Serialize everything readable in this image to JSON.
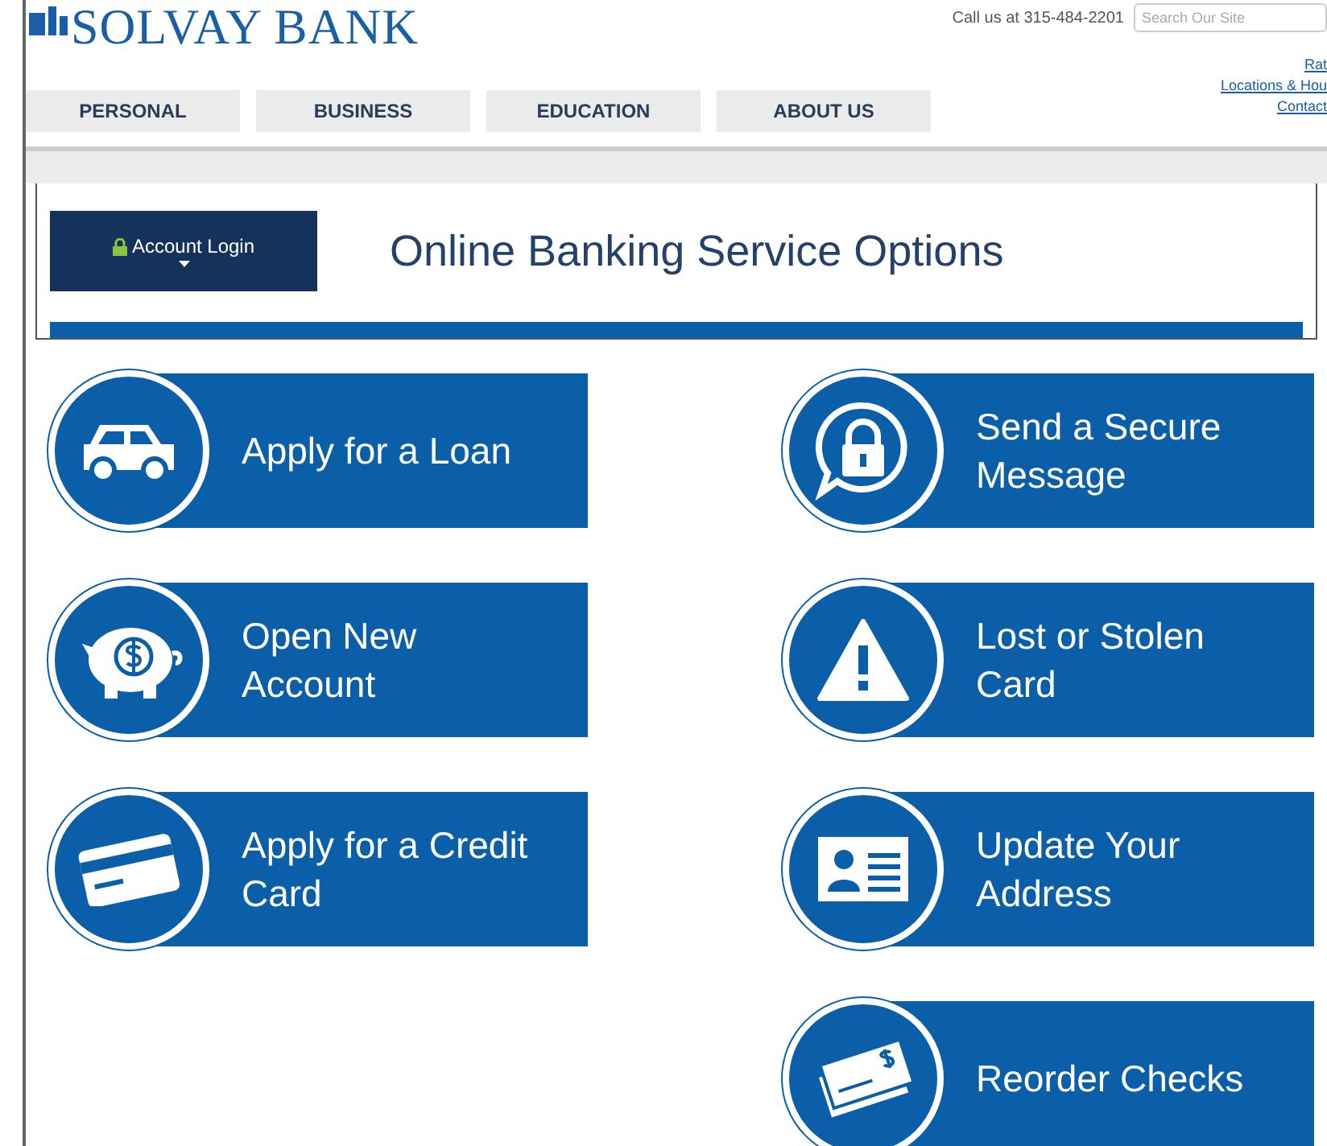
{
  "header": {
    "logo": "SOLVAY BANK",
    "call": "Call us at 315-484-2201",
    "search": {
      "placeholder": "Search Our Site"
    },
    "links": [
      "Rat",
      "Locations & Hou",
      "Contact"
    ]
  },
  "nav": [
    {
      "label": "PERSONAL"
    },
    {
      "label": "BUSINESS"
    },
    {
      "label": "EDUCATION"
    },
    {
      "label": "ABOUT US"
    }
  ],
  "panel": {
    "login_button": "Account Login",
    "title": "Online Banking Service Options"
  },
  "left_options": [
    {
      "kind": "car",
      "label": "Apply for a Loan"
    },
    {
      "kind": "piggy",
      "label": "Open New Account"
    },
    {
      "kind": "card",
      "label": "Apply for a Credit Card"
    }
  ],
  "right_options": [
    {
      "kind": "lock",
      "label": "Send a Secure Message"
    },
    {
      "kind": "warning",
      "label": "Lost or Stolen Card"
    },
    {
      "kind": "id",
      "label": "Update Your Address"
    },
    {
      "kind": "checks",
      "label": "Reorder Checks"
    }
  ]
}
